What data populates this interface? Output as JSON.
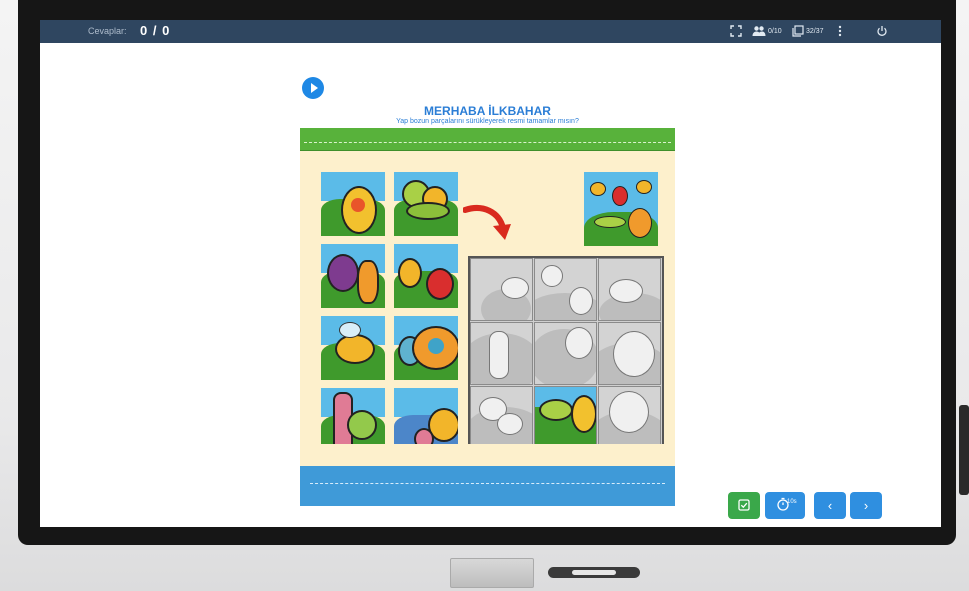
{
  "topbar": {
    "answers_label": "Cevaplar:",
    "answers_value": "0 / 0",
    "users_count": "0/10",
    "page_count": "32/37"
  },
  "activity": {
    "title": "MERHABA İLKBAHAR",
    "instruction": "Yap bozun parçalarını sürükleyerek resmi tamamlar mısın?"
  },
  "puzzle": {
    "pieces_remaining": 8,
    "pieces_placed": 1,
    "board_rows": 3,
    "board_cols": 3
  },
  "bottom_toolbar": {
    "check_icon": "check-box-icon",
    "timer_icon": "timer-icon",
    "timer_label": "10s",
    "prev_label": "‹",
    "next_label": "›"
  },
  "colors": {
    "topbar": "#2f4660",
    "accent_blue": "#2b7ed6",
    "check_green": "#3aa84a",
    "nav_blue": "#2f8fe0"
  }
}
